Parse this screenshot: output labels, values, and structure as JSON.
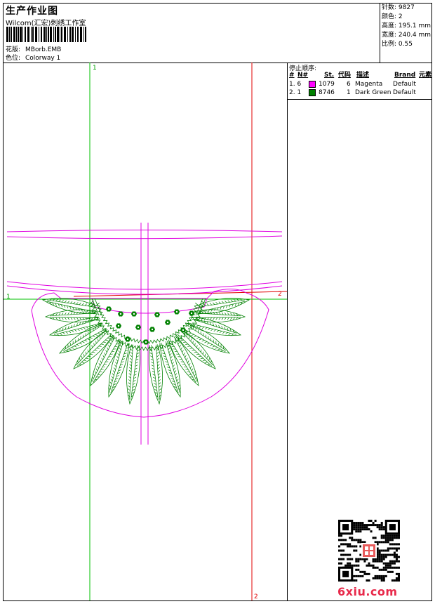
{
  "header": {
    "title": "生产作业图",
    "studio": "Wilcom(汇宏)刺绣工作室",
    "design_label": "花版:",
    "design_value": "MBorb.EMB",
    "colorway_label": "色位:",
    "colorway_value": "Colorway 1"
  },
  "stats": {
    "stitches": "针数: 9827",
    "colors": "颜色: 2",
    "height": "高度: 195.1 mm",
    "width": "宽度: 240.4 mm",
    "ratio": "比例: 0.55"
  },
  "stop_sequence": {
    "title": "停止顺序:",
    "headers": [
      "#",
      "N#",
      "St.",
      "代码",
      "描述",
      "Brand",
      "元素"
    ],
    "rows": [
      {
        "num": "1. 6",
        "code": "1079",
        "st": "6",
        "name": "Magenta",
        "brand": "Default",
        "color": "#ff00ff"
      },
      {
        "num": "2. 1",
        "code": "8746",
        "st": "1",
        "name": "Dark Green",
        "brand": "Default",
        "color": "#008000"
      }
    ]
  },
  "canvas": {
    "guide_label_top": "1",
    "guide_label_left": "1",
    "guide_label_right": "2",
    "guide_label_bottom": "2",
    "outline_color": "#e000e0",
    "stitch_color": "#008000",
    "guide_green": "#00c000",
    "guide_red": "#e00000"
  },
  "watermark": {
    "brand": "6xiu.com",
    "qr_icon": "qr-code-icon",
    "seal_icon": "seal-stamp-icon"
  }
}
